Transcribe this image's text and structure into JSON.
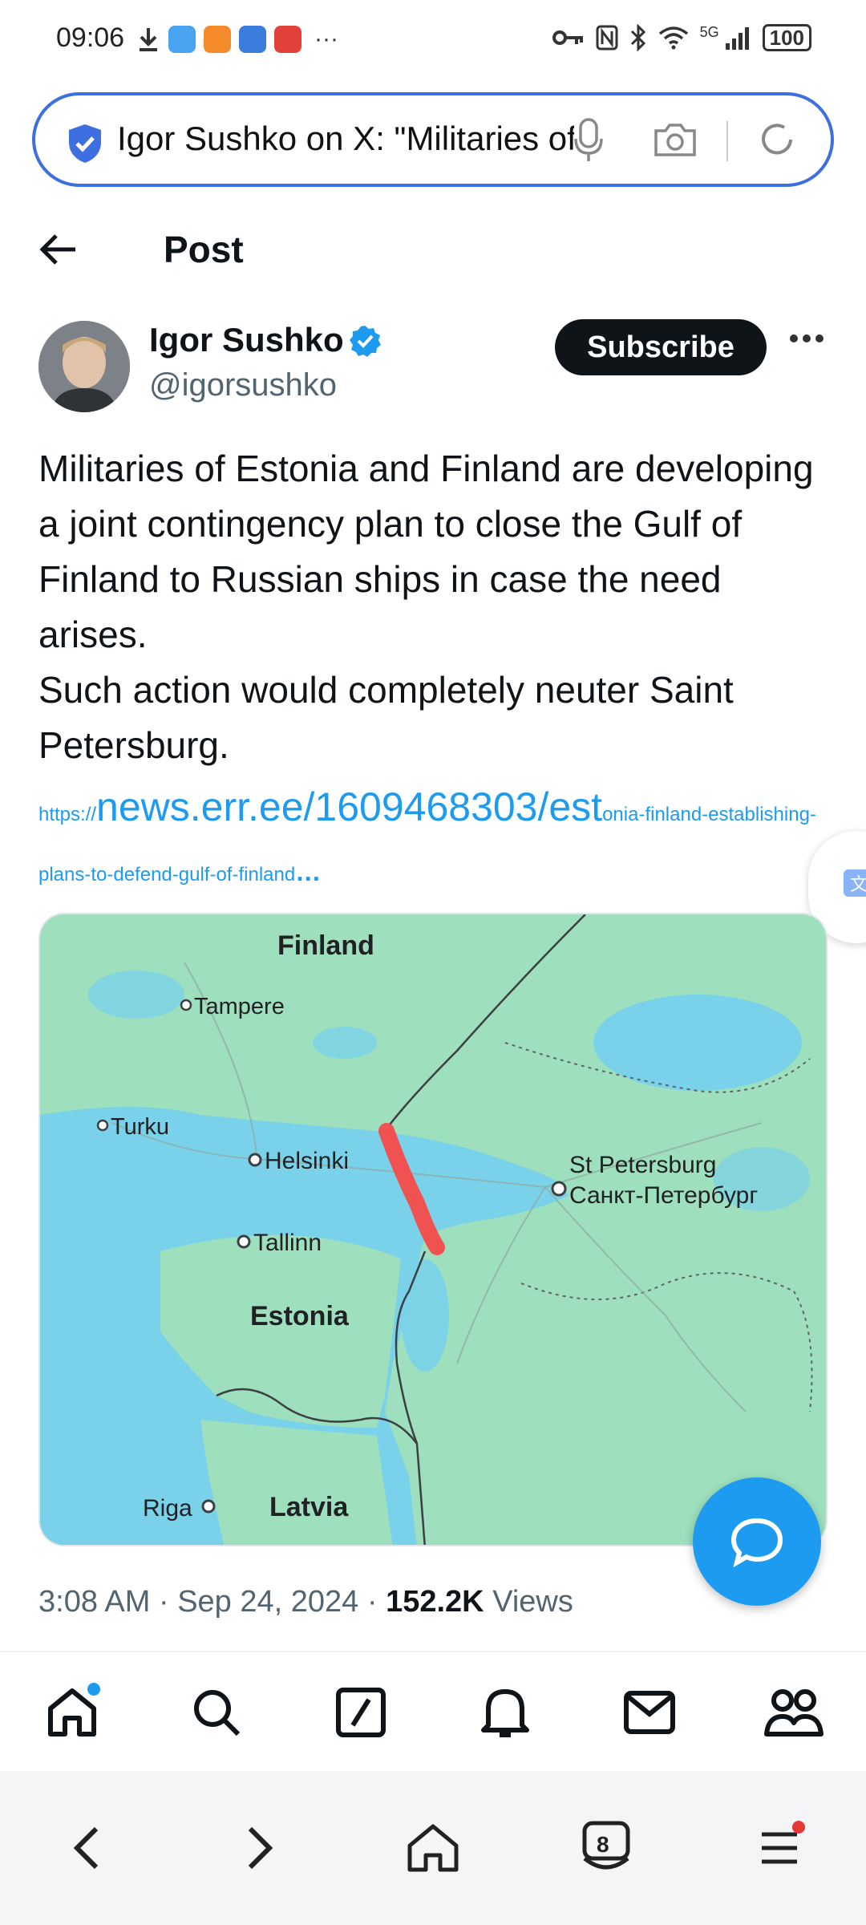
{
  "status_bar": {
    "time": "09:06",
    "ellipsis": "···",
    "network": "5G",
    "battery": "100"
  },
  "address_bar": {
    "url_title": "Igor Sushko on X: \"Militaries of Estonia and Finland are developing"
  },
  "header": {
    "title": "Post"
  },
  "author": {
    "name": "Igor Sushko",
    "handle": "@igorsushko",
    "subscribe_label": "Subscribe"
  },
  "post": {
    "text": "Militaries of Estonia and Finland are developing a joint contingency plan to close the Gulf of Finland to Russian ships in case the need arises.\nSuch action would completely neuter Saint Petersburg.",
    "link_prefix": "https://",
    "link_main": "news.err.ee/1609468303/est",
    "link_rest": "onia-finland-establishing-plans-to-defend-gulf-of-finland",
    "link_ellipsis": "…"
  },
  "map": {
    "labels": {
      "finland": "Finland",
      "tampere": "Tampere",
      "turku": "Turku",
      "helsinki": "Helsinki",
      "tallinn": "Tallinn",
      "estonia": "Estonia",
      "st_petersburg": "St Petersburg",
      "st_petersburg_ru": "Санкт-Петербург",
      "riga": "Riga",
      "latvia": "Latvia"
    },
    "colors": {
      "land": "#9ee0bd",
      "water": "#79d2ea",
      "blockade_line": "#f05252"
    }
  },
  "meta": {
    "time": "3:08 AM",
    "date": "Sep 24, 2024",
    "views_count": "152.2K",
    "views_label": "Views"
  },
  "bottom_nav": [
    "home-icon",
    "search-icon",
    "grok-icon",
    "notifications-icon",
    "messages-icon",
    "communities-icon"
  ],
  "browser_toolbar": {
    "tab_count": "8"
  },
  "colors": {
    "accent": "#1d9bf0",
    "text": "#0f1419",
    "muted": "#536471"
  }
}
